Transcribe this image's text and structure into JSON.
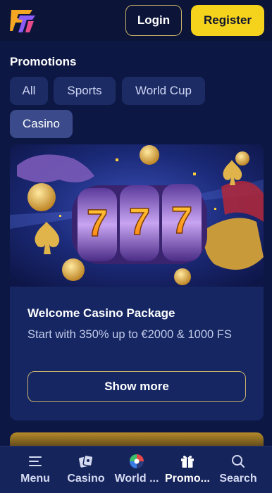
{
  "header": {
    "logo": "brand-logo",
    "login_label": "Login",
    "register_label": "Register"
  },
  "promotions": {
    "title": "Promotions",
    "filters": [
      {
        "label": "All",
        "active": false
      },
      {
        "label": "Sports",
        "active": false
      },
      {
        "label": "World Cup",
        "active": false
      },
      {
        "label": "Casino",
        "active": true
      }
    ]
  },
  "promo_card": {
    "image": "casino-slot-777-banner",
    "title": "Welcome Casino Package",
    "description": "Start with 350% up to €2000 & 1000 FS",
    "button_label": "Show more"
  },
  "bottom_nav": {
    "items": [
      {
        "label": "Menu",
        "icon": "menu-icon"
      },
      {
        "label": "Casino",
        "icon": "casino-icon"
      },
      {
        "label": "World ...",
        "icon": "soccer-ball-icon"
      },
      {
        "label": "Promo...",
        "icon": "gift-icon",
        "active": true
      },
      {
        "label": "Search",
        "icon": "search-icon"
      }
    ]
  },
  "colors": {
    "background": "#0d1744",
    "accent": "#f5d21c",
    "chip": "#1c2b64",
    "chip_active": "#3a4a8a",
    "card": "#152663",
    "border_gold": "#c8b26a"
  }
}
